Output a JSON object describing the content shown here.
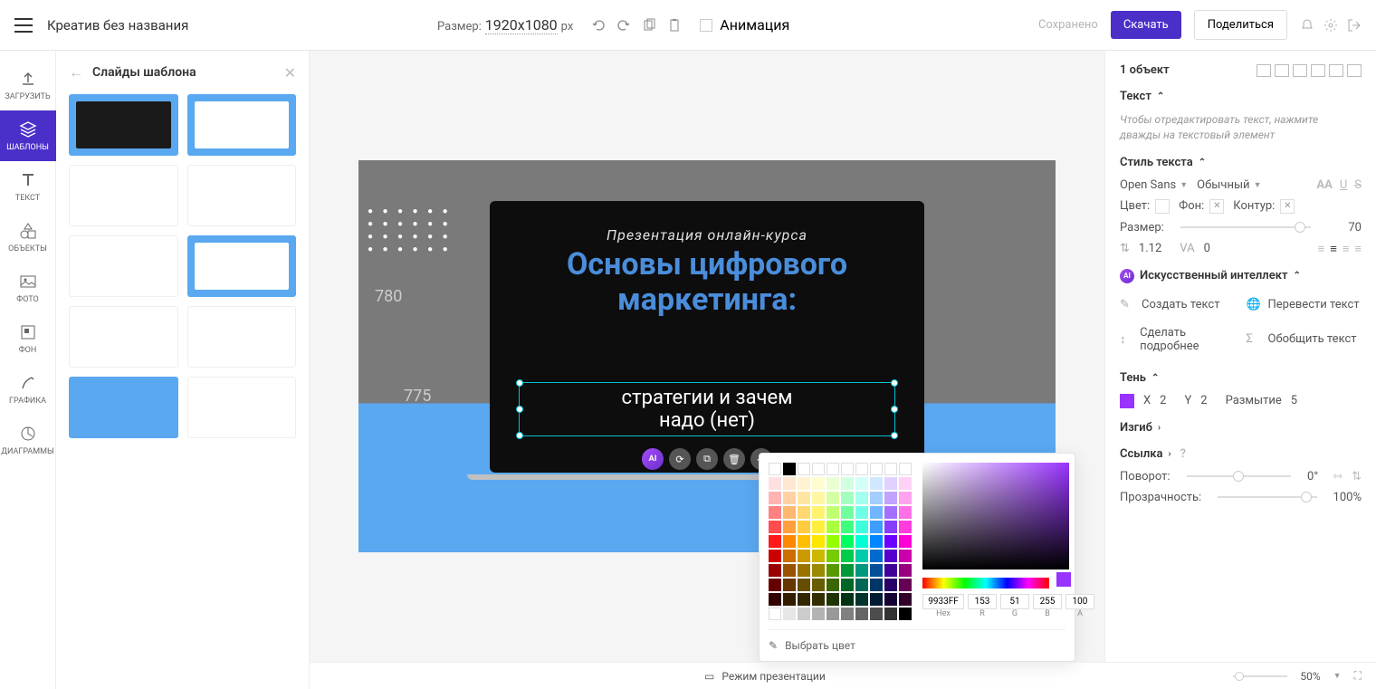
{
  "header": {
    "doc_title": "Креатив без названия",
    "size_label": "Размер:",
    "size_value": "1920x1080",
    "size_unit": "px",
    "animation_label": "Анимация",
    "saved_label": "Сохранено",
    "download_label": "Скачать",
    "share_label": "Поделиться"
  },
  "rail": {
    "upload": "ЗАГРУЗИТЬ",
    "templates": "ШАБЛОНЫ",
    "text": "ТЕКСТ",
    "objects": "ОБЪЕКТЫ",
    "photo": "ФОТО",
    "background": "ФОН",
    "graphic": "ГРАФИКА",
    "diagrams": "ДИАГРАММЫ"
  },
  "tpl_panel": {
    "title": "Слайды шаблона"
  },
  "canvas": {
    "arc_text": "Презентация онлайн-курса",
    "line1": "Основы цифрового",
    "line2": "маркетинга:",
    "sel_line1": "стратегии и зачем",
    "sel_line2": "надо (нет)",
    "bg_num1": "780",
    "bg_num2": "775"
  },
  "color_picker": {
    "hex": "9933FF",
    "r": "153",
    "g": "51",
    "b": "255",
    "a": "100",
    "hex_label": "Hex",
    "r_label": "R",
    "g_label": "G",
    "b_label": "B",
    "a_label": "A",
    "pick_label": "Выбрать цвет",
    "swatches": [
      "#ffffff",
      "#000000",
      "",
      "",
      "",
      "",
      "",
      "",
      "",
      "",
      "#ffe0e0",
      "#ffe8d1",
      "#fff3d1",
      "#fffcd1",
      "#eaffd1",
      "#d1ffe0",
      "#d1fff7",
      "#d1e7ff",
      "#e0d1ff",
      "#ffd1f7",
      "#ffb3b3",
      "#ffd1a3",
      "#ffe6a3",
      "#fff7a3",
      "#d6ffa3",
      "#a3ffbf",
      "#a3ffee",
      "#a3ceff",
      "#c2a3ff",
      "#ffa3ee",
      "#ff8080",
      "#ffb870",
      "#ffd970",
      "#fff270",
      "#c0ff70",
      "#70ff9e",
      "#70ffe6",
      "#70b6ff",
      "#a470ff",
      "#ff70e6",
      "#ff4d4d",
      "#ffa03d",
      "#ffcc3d",
      "#ffee3d",
      "#aaff3d",
      "#3dff7e",
      "#3dffdd",
      "#3d9eff",
      "#873dff",
      "#ff3ddd",
      "#ff1a1a",
      "#ff8800",
      "#ffbf00",
      "#ffe600",
      "#94ff00",
      "#00ff5e",
      "#00ffd5",
      "#0086ff",
      "#6a00ff",
      "#ff00d5",
      "#cc0000",
      "#cc6d00",
      "#cc9900",
      "#ccb800",
      "#76cc00",
      "#00cc4b",
      "#00ccaa",
      "#006bcc",
      "#5500cc",
      "#cc00aa",
      "#990000",
      "#995200",
      "#997300",
      "#998a00",
      "#599900",
      "#009938",
      "#009980",
      "#005099",
      "#400099",
      "#990080",
      "#660000",
      "#663600",
      "#664d00",
      "#665c00",
      "#3b6600",
      "#006626",
      "#006655",
      "#003566",
      "#2a0066",
      "#660055",
      "#330000",
      "#331b00",
      "#332600",
      "#332e00",
      "#1d3300",
      "#003313",
      "#00332b",
      "#001b33",
      "#150033",
      "#33002b",
      "#ffffff",
      "#e6e6e6",
      "#cccccc",
      "#b3b3b3",
      "#999999",
      "#808080",
      "#666666",
      "#4d4d4d",
      "#333333",
      "#000000"
    ]
  },
  "props": {
    "object_count": "1 объект",
    "text_section": "Текст",
    "text_hint": "Чтобы отредактировать текст, нажмите дважды на текстовый элемент",
    "style_section": "Стиль текста",
    "font": "Open Sans",
    "weight": "Обычный",
    "color_label": "Цвет:",
    "bg_label": "Фон:",
    "outline_label": "Контур:",
    "size_label": "Размер:",
    "size_value": "70",
    "lineheight_value": "1.12",
    "letterspacing_value": "0",
    "ai_section": "Искусственный интеллект",
    "ai_create": "Создать текст",
    "ai_translate": "Перевести текст",
    "ai_expand": "Сделать подробнее",
    "ai_summarize": "Обобщить текст",
    "shadow_section": "Тень",
    "shadow_x_label": "X",
    "shadow_x": "2",
    "shadow_y_label": "Y",
    "shadow_y": "2",
    "blur_label": "Размытие",
    "blur": "5",
    "curve_section": "Изгиб",
    "link_section": "Ссылка",
    "rotate_label": "Поворот:",
    "rotate_value": "0°",
    "opacity_label": "Прозрачность:",
    "opacity_value": "100%"
  },
  "status": {
    "presentation_mode": "Режим презентации",
    "zoom": "50%"
  }
}
